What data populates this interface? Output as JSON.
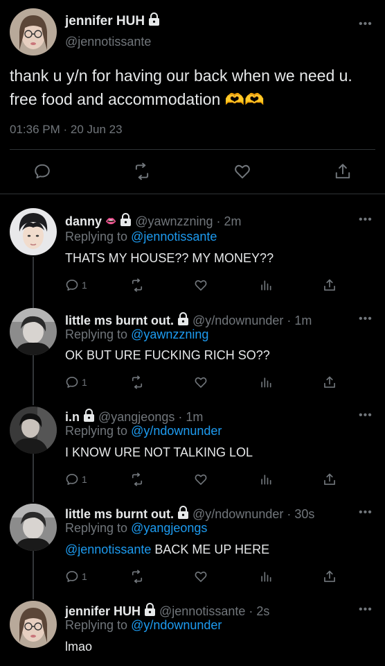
{
  "main_tweet": {
    "name": "jennifer HUH",
    "handle": "@jennotissante",
    "text": "thank u y/n for having our back when we need u. free food and accommodation 🫶🫶",
    "timestamp": "01:36 PM · 20 Jun 23",
    "icons": [
      "reply-icon",
      "retweet-icon",
      "like-icon",
      "share-icon"
    ]
  },
  "replies": [
    {
      "name": "danny",
      "emoji": "👄",
      "handle": "@yawnzzning",
      "time": "· 2m",
      "replying_label": "Replying to",
      "replying_to": "@jennotissante",
      "mention": "",
      "text": "THATS MY HOUSE?? MY MONEY??",
      "reply_count": "1"
    },
    {
      "name": "little ms burnt out.",
      "emoji": "",
      "handle": "@y/ndownunder",
      "time": "· 1m",
      "replying_label": "Replying to",
      "replying_to": "@yawnzzning",
      "mention": "",
      "text": "OK BUT URE FUCKING RICH SO??",
      "reply_count": "1"
    },
    {
      "name": "i.n",
      "emoji": "",
      "handle": "@yangjeongs",
      "time": "· 1m",
      "replying_label": "Replying to",
      "replying_to": "@y/ndownunder",
      "mention": "",
      "text": "I KNOW URE NOT TALKING LOL",
      "reply_count": "1"
    },
    {
      "name": "little ms burnt out.",
      "emoji": "",
      "handle": "@y/ndownunder",
      "time": "· 30s",
      "replying_label": "Replying to",
      "replying_to": "@yangjeongs",
      "mention": "@jennotissante",
      "text": " BACK ME UP HERE",
      "reply_count": "1"
    },
    {
      "name": "jennifer HUH",
      "emoji": "",
      "handle": "@jennotissante",
      "time": "· 2s",
      "replying_label": "Replying to",
      "replying_to": "@y/ndownunder",
      "mention": "",
      "text": "lmao",
      "reply_count": ""
    }
  ],
  "colors": {
    "background": "#000000",
    "text": "#e7e9ea",
    "muted": "#71767b",
    "link": "#1d9bf0",
    "divider": "#2f3336"
  }
}
